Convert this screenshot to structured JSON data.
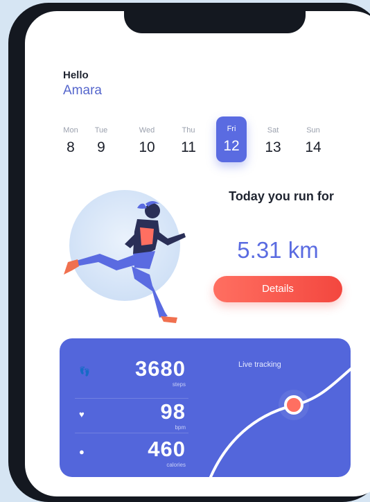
{
  "greeting": {
    "hello": "Hello",
    "name": "Amara"
  },
  "week": [
    {
      "name": "Mon",
      "date": "8"
    },
    {
      "name": "Tue",
      "date": "9"
    },
    {
      "name": "Wed",
      "date": "10"
    },
    {
      "name": "Thu",
      "date": "11"
    },
    {
      "name": "Fri",
      "date": "12"
    },
    {
      "name": "Sat",
      "date": "13"
    },
    {
      "name": "Sun",
      "date": "14"
    }
  ],
  "run": {
    "headline": "Today you run for",
    "distance": "5.31 km",
    "details_label": "Details"
  },
  "stats": {
    "live_label": "Live tracking",
    "items": [
      {
        "icon": "footsteps-icon",
        "value": "3680",
        "unit": "steps"
      },
      {
        "icon": "heart-icon",
        "value": "98",
        "unit": "bpm"
      },
      {
        "icon": "flame-icon",
        "value": "460",
        "unit": "calories"
      }
    ]
  },
  "colors": {
    "accent": "#5a6be1",
    "card": "#5366db",
    "button": "#f3473f",
    "background": "#d6e5f3"
  }
}
